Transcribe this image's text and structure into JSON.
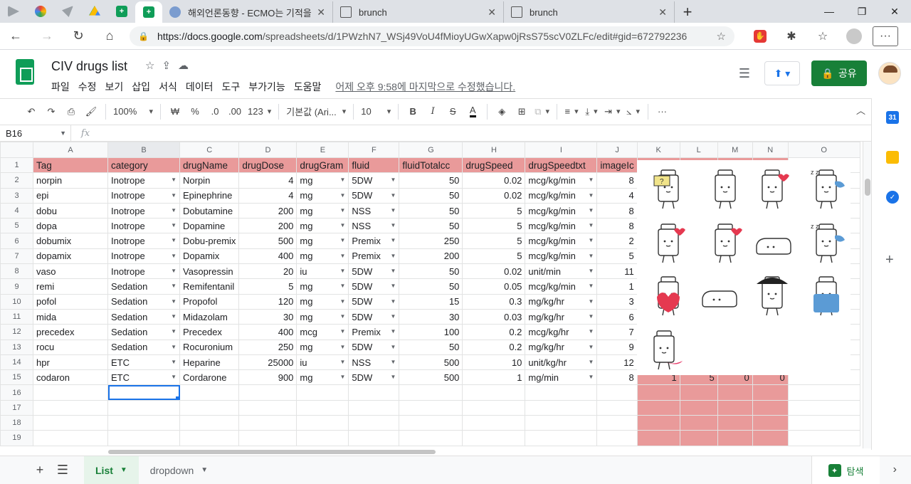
{
  "browser": {
    "tabs": [
      {
        "title": "해외언론동향 - ECMO는 기적을",
        "favicon_color": "#7b9ccf"
      },
      {
        "title": "brunch",
        "favicon_color": "#555555"
      },
      {
        "title": "brunch",
        "favicon_color": "#555555"
      }
    ],
    "url_prefix": "https://docs.google.com",
    "url_rest": "/spreadsheets/d/1PWzhN7_WSj49VoU4fMioyUGwXapw0jRsS75scV0ZLFc/edit#gid=672792236"
  },
  "doc": {
    "title": "CIV drugs list",
    "menus": [
      "파일",
      "수정",
      "보기",
      "삽입",
      "서식",
      "데이터",
      "도구",
      "부가기능",
      "도움말"
    ],
    "last_edit": "어제 오후 9:58에 마지막으로 수정했습니다.",
    "share_label": "공유"
  },
  "toolbar": {
    "zoom": "100%",
    "currency": "₩",
    "percent": "%",
    "dec_decrease": ".0",
    "dec_increase": ".00",
    "format_more": "123",
    "font": "기본값 (Ari...",
    "font_size": "10"
  },
  "formula": {
    "cell_ref": "B16",
    "fx": "fx"
  },
  "grid": {
    "columns": [
      "A",
      "B",
      "C",
      "D",
      "E",
      "F",
      "G",
      "H",
      "I",
      "J",
      "K",
      "L",
      "M",
      "N",
      "O"
    ],
    "header_row": [
      "Tag",
      "category",
      "drugName",
      "drugDose",
      "drugGram",
      "fluid",
      "fluidTotalcc",
      "drugSpeed",
      "drugSpeedtxt",
      "imageIc"
    ],
    "rows": [
      [
        "norpin",
        "Inotrope",
        "Norpin",
        "4",
        "mg",
        "5DW",
        "50",
        "0.02",
        "mcg/kg/min",
        "8"
      ],
      [
        "epi",
        "Inotrope",
        "Epinephrine",
        "4",
        "mg",
        "5DW",
        "50",
        "0.02",
        "mcg/kg/min",
        "4"
      ],
      [
        "dobu",
        "Inotrope",
        "Dobutamine",
        "200",
        "mg",
        "NSS",
        "50",
        "5",
        "mcg/kg/min",
        "8"
      ],
      [
        "dopa",
        "Inotrope",
        "Dopamine",
        "200",
        "mg",
        "NSS",
        "50",
        "5",
        "mcg/kg/min",
        "8"
      ],
      [
        "dobumix",
        "Inotrope",
        "Dobu-premix",
        "500",
        "mg",
        "Premix",
        "250",
        "5",
        "mcg/kg/min",
        "2"
      ],
      [
        "dopamix",
        "Inotrope",
        "Dopamix",
        "400",
        "mg",
        "Premix",
        "200",
        "5",
        "mcg/kg/min",
        "5"
      ],
      [
        "vaso",
        "Inotrope",
        "Vasopressin",
        "20",
        "iu",
        "5DW",
        "50",
        "0.02",
        "unit/min",
        "11"
      ],
      [
        "remi",
        "Sedation",
        "Remifentanil",
        "5",
        "mg",
        "5DW",
        "50",
        "0.05",
        "mcg/kg/min",
        "1"
      ],
      [
        "pofol",
        "Sedation",
        "Propofol",
        "120",
        "mg",
        "5DW",
        "15",
        "0.3",
        "mg/kg/hr",
        "3"
      ],
      [
        "mida",
        "Sedation",
        "Midazolam",
        "30",
        "mg",
        "5DW",
        "30",
        "0.03",
        "mg/kg/hr",
        "6"
      ],
      [
        "precedex",
        "Sedation",
        "Precedex",
        "400",
        "mcg",
        "Premix",
        "100",
        "0.2",
        "mcg/kg/hr",
        "7"
      ],
      [
        "rocu",
        "Sedation",
        "Rocuronium",
        "250",
        "mg",
        "5DW",
        "50",
        "0.2",
        "mg/kg/hr",
        "9"
      ],
      [
        "hpr",
        "ETC",
        "Heparine",
        "25000",
        "iu",
        "NSS",
        "500",
        "10",
        "unit/kg/hr",
        "12"
      ],
      [
        "codaron",
        "ETC",
        "Cordarone",
        "900",
        "mg",
        "5DW",
        "500",
        "1",
        "mg/min",
        "8"
      ]
    ],
    "row15_extra": [
      "1",
      "5",
      "0",
      "0"
    ],
    "row_numbers": [
      "1",
      "2",
      "3",
      "4",
      "5",
      "6",
      "7",
      "8",
      "9",
      "10",
      "11",
      "12",
      "13",
      "14",
      "15",
      "16",
      "17",
      "18",
      "19"
    ],
    "header_color": "#e99a9a"
  },
  "sheets": {
    "tabs": [
      {
        "label": "List",
        "active": true
      },
      {
        "label": "dropdown",
        "active": false
      }
    ],
    "explore_label": "탐색"
  }
}
